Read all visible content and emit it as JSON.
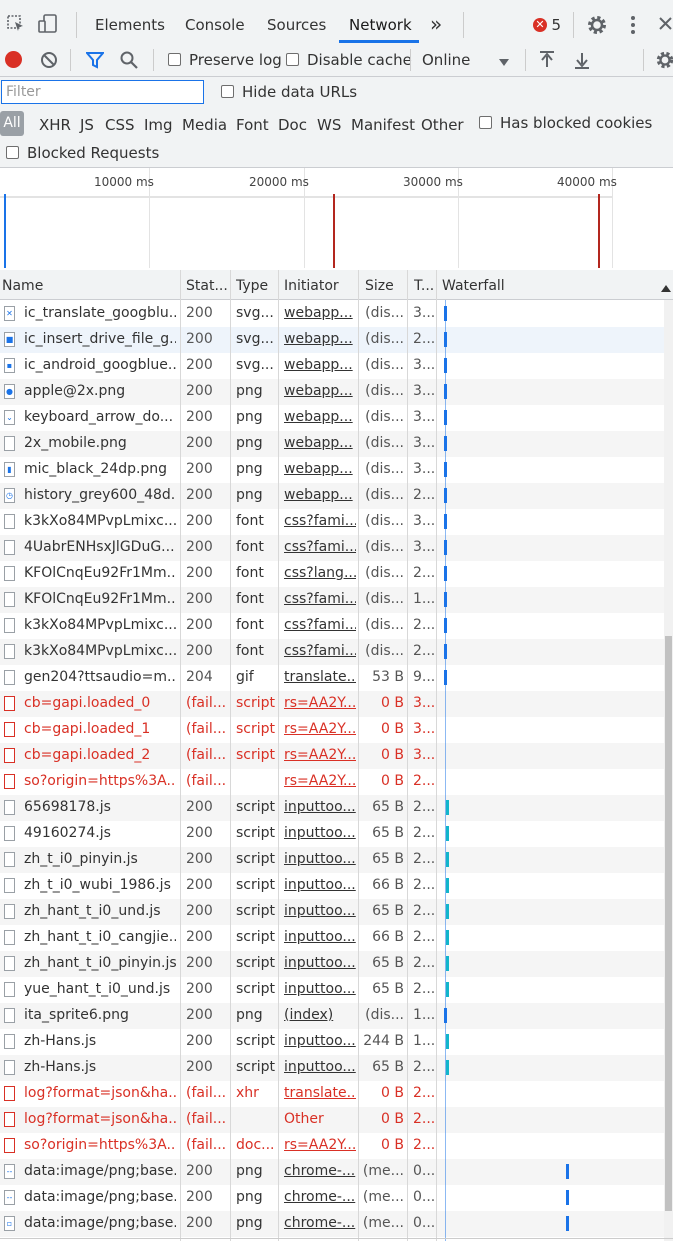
{
  "tabs": {
    "items": [
      "Elements",
      "Console",
      "Sources",
      "Network"
    ],
    "active": "Network",
    "more": "»",
    "error_count": "5"
  },
  "toolbar": {
    "preserve_log": "Preserve log",
    "disable_cache": "Disable cache",
    "throttle": "Online"
  },
  "filter": {
    "placeholder": "Filter",
    "hide_data_urls": "Hide data URLs",
    "types": [
      "All",
      "XHR",
      "JS",
      "CSS",
      "Img",
      "Media",
      "Font",
      "Doc",
      "WS",
      "Manifest",
      "Other"
    ],
    "has_blocked_cookies": "Has blocked cookies",
    "blocked_requests": "Blocked Requests"
  },
  "overview": {
    "ticks": [
      "10000 ms",
      "20000 ms",
      "30000 ms",
      "40000 ms"
    ]
  },
  "columns": [
    "Name",
    "Stat...",
    "Type",
    "Initiator",
    "Size",
    "T...",
    "Waterfall"
  ],
  "rows": [
    {
      "name": "ic_translate_googblu...",
      "status": "200",
      "type": "svg...",
      "initiator": "webapp...",
      "size": "(dis...",
      "time": "3...",
      "icon": "✕"
    },
    {
      "name": "ic_insert_drive_file_g...",
      "status": "200",
      "type": "svg...",
      "initiator": "webapp...",
      "size": "(dis...",
      "time": "2...",
      "icon": "■"
    },
    {
      "name": "ic_android_googblue...",
      "status": "200",
      "type": "svg...",
      "initiator": "webapp...",
      "size": "(dis...",
      "time": "3...",
      "icon": "▪"
    },
    {
      "name": "apple@2x.png",
      "status": "200",
      "type": "png",
      "initiator": "webapp...",
      "size": "(dis...",
      "time": "3...",
      "icon": "●"
    },
    {
      "name": "keyboard_arrow_do...",
      "status": "200",
      "type": "png",
      "initiator": "webapp...",
      "size": "(dis...",
      "time": "3...",
      "icon": "⌄"
    },
    {
      "name": "2x_mobile.png",
      "status": "200",
      "type": "png",
      "initiator": "webapp...",
      "size": "(dis...",
      "time": "3...",
      "icon": ""
    },
    {
      "name": "mic_black_24dp.png",
      "status": "200",
      "type": "png",
      "initiator": "webapp...",
      "size": "(dis...",
      "time": "3...",
      "icon": "▮"
    },
    {
      "name": "history_grey600_48d...",
      "status": "200",
      "type": "png",
      "initiator": "webapp...",
      "size": "(dis...",
      "time": "2...",
      "icon": "◷"
    },
    {
      "name": "k3kXo84MPvpLmixc...",
      "status": "200",
      "type": "font",
      "initiator": "css?fami...",
      "size": "(dis...",
      "time": "3...",
      "icon": ""
    },
    {
      "name": "4UabrENHsxJlGDuG...",
      "status": "200",
      "type": "font",
      "initiator": "css?fami...",
      "size": "(dis...",
      "time": "3...",
      "icon": ""
    },
    {
      "name": "KFOlCnqEu92Fr1Mm...",
      "status": "200",
      "type": "font",
      "initiator": "css?lang...",
      "size": "(dis...",
      "time": "2...",
      "icon": ""
    },
    {
      "name": "KFOlCnqEu92Fr1Mm...",
      "status": "200",
      "type": "font",
      "initiator": "css?fami...",
      "size": "(dis...",
      "time": "1...",
      "icon": ""
    },
    {
      "name": "k3kXo84MPvpLmixc...",
      "status": "200",
      "type": "font",
      "initiator": "css?fami...",
      "size": "(dis...",
      "time": "2...",
      "icon": ""
    },
    {
      "name": "k3kXo84MPvpLmixc...",
      "status": "200",
      "type": "font",
      "initiator": "css?fami...",
      "size": "(dis...",
      "time": "2...",
      "icon": ""
    },
    {
      "name": "gen204?ttsaudio=m...",
      "status": "204",
      "type": "gif",
      "initiator": "translate...",
      "size": "53 B",
      "time": "9...",
      "icon": ""
    },
    {
      "name": "cb=gapi.loaded_0",
      "status": "(fail...",
      "type": "script",
      "initiator": "rs=AA2Y...",
      "size": "0 B",
      "time": "3...",
      "icon": "",
      "fail": true
    },
    {
      "name": "cb=gapi.loaded_1",
      "status": "(fail...",
      "type": "script",
      "initiator": "rs=AA2Y...",
      "size": "0 B",
      "time": "3...",
      "icon": "",
      "fail": true
    },
    {
      "name": "cb=gapi.loaded_2",
      "status": "(fail...",
      "type": "script",
      "initiator": "rs=AA2Y...",
      "size": "0 B",
      "time": "3...",
      "icon": "",
      "fail": true
    },
    {
      "name": "so?origin=https%3A...",
      "status": "(fail...",
      "type": "",
      "initiator": "rs=AA2Y...",
      "size": "0 B",
      "time": "2...",
      "icon": "",
      "fail": true
    },
    {
      "name": "65698178.js",
      "status": "200",
      "type": "script",
      "initiator": "inputtoo...",
      "size": "65 B",
      "time": "2...",
      "icon": ""
    },
    {
      "name": "49160274.js",
      "status": "200",
      "type": "script",
      "initiator": "inputtoo...",
      "size": "65 B",
      "time": "2...",
      "icon": ""
    },
    {
      "name": "zh_t_i0_pinyin.js",
      "status": "200",
      "type": "script",
      "initiator": "inputtoo...",
      "size": "65 B",
      "time": "2...",
      "icon": ""
    },
    {
      "name": "zh_t_i0_wubi_1986.js",
      "status": "200",
      "type": "script",
      "initiator": "inputtoo...",
      "size": "66 B",
      "time": "2...",
      "icon": ""
    },
    {
      "name": "zh_hant_t_i0_und.js",
      "status": "200",
      "type": "script",
      "initiator": "inputtoo...",
      "size": "65 B",
      "time": "2...",
      "icon": ""
    },
    {
      "name": "zh_hant_t_i0_cangjie...",
      "status": "200",
      "type": "script",
      "initiator": "inputtoo...",
      "size": "66 B",
      "time": "2...",
      "icon": ""
    },
    {
      "name": "zh_hant_t_i0_pinyin.js",
      "status": "200",
      "type": "script",
      "initiator": "inputtoo...",
      "size": "65 B",
      "time": "2...",
      "icon": ""
    },
    {
      "name": "yue_hant_t_i0_und.js",
      "status": "200",
      "type": "script",
      "initiator": "inputtoo...",
      "size": "65 B",
      "time": "2...",
      "icon": ""
    },
    {
      "name": "ita_sprite6.png",
      "status": "200",
      "type": "png",
      "initiator": "(index)",
      "size": "(dis...",
      "time": "1...",
      "icon": ""
    },
    {
      "name": "zh-Hans.js",
      "status": "200",
      "type": "script",
      "initiator": "inputtoo...",
      "size": "244 B",
      "time": "1...",
      "icon": ""
    },
    {
      "name": "zh-Hans.js",
      "status": "200",
      "type": "script",
      "initiator": "inputtoo...",
      "size": "65 B",
      "time": "2...",
      "icon": ""
    },
    {
      "name": "log?format=json&ha...",
      "status": "(fail...",
      "type": "xhr",
      "initiator": "translate...",
      "size": "0 B",
      "time": "2...",
      "icon": "",
      "fail": true
    },
    {
      "name": "log?format=json&ha...",
      "status": "(fail...",
      "type": "",
      "initiator": "Other",
      "size": "0 B",
      "time": "2...",
      "icon": "",
      "fail": true,
      "plain": true
    },
    {
      "name": "so?origin=https%3A...",
      "status": "(fail...",
      "type": "doc...",
      "initiator": "rs=AA2Y...",
      "size": "0 B",
      "time": "2...",
      "icon": "",
      "fail": true
    },
    {
      "name": "data:image/png;base...",
      "status": "200",
      "type": "png",
      "initiator": "chrome-...",
      "size": "(me...",
      "time": "0...",
      "icon": "--"
    },
    {
      "name": "data:image/png;base...",
      "status": "200",
      "type": "png",
      "initiator": "chrome-...",
      "size": "(me...",
      "time": "0...",
      "icon": "--"
    },
    {
      "name": "data:image/png;base...",
      "status": "200",
      "type": "png",
      "initiator": "chrome-...",
      "size": "(me...",
      "time": "0...",
      "icon": "▫"
    }
  ],
  "colors": {
    "accent": "#1a73e8",
    "fail_text": "#d93025",
    "record": "#d93025",
    "waterfall_blue": "#1a73e8",
    "waterfall_teal": "#12b5cb"
  }
}
